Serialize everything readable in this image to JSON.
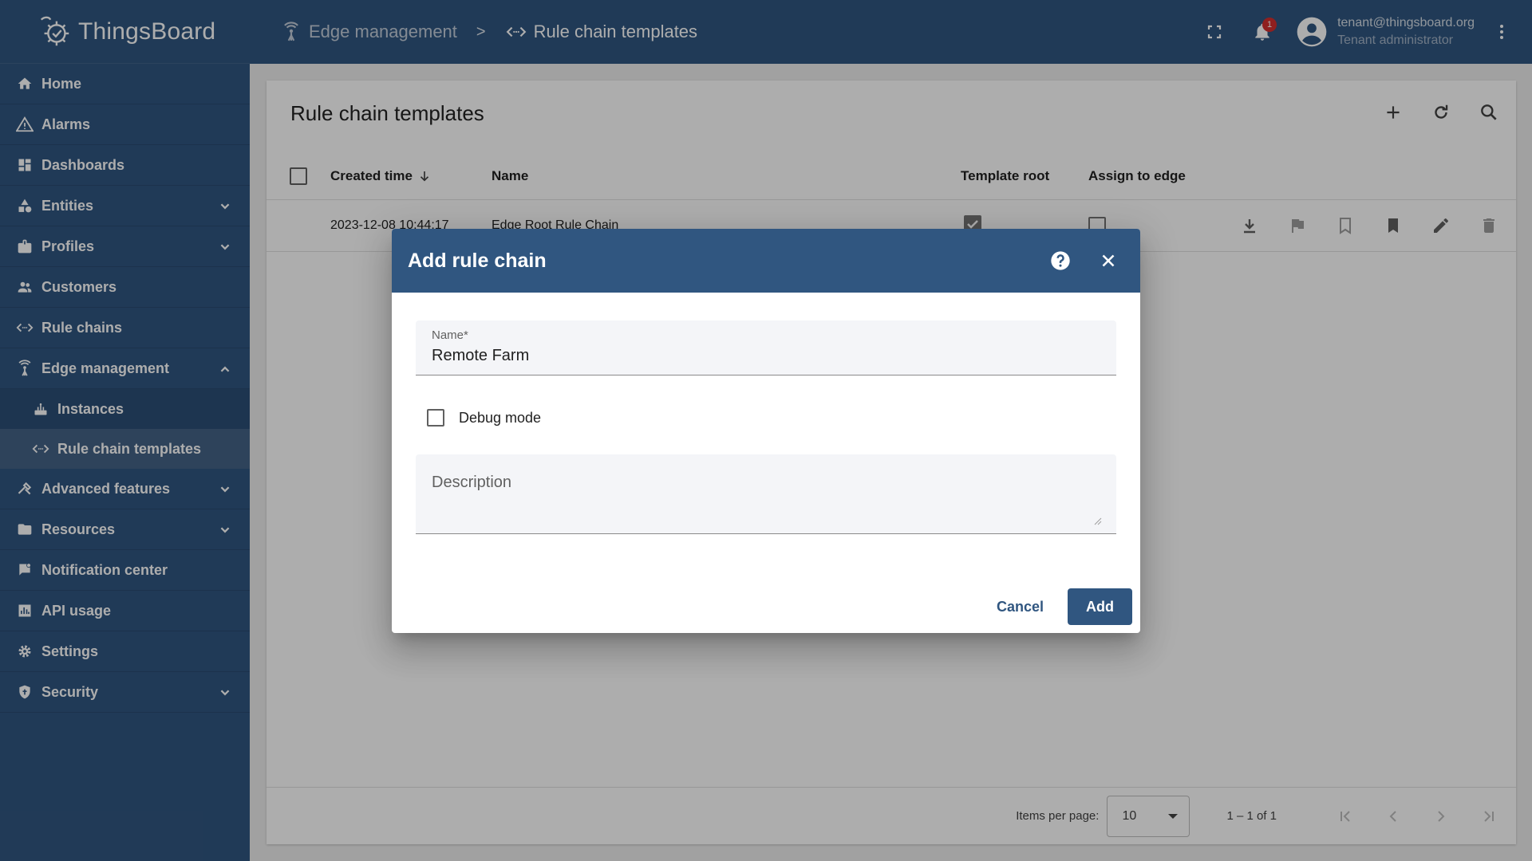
{
  "app": {
    "name": "ThingsBoard"
  },
  "colors": {
    "primary": "#305680",
    "notification_badge": "#d32f2f"
  },
  "sidebar": {
    "items": [
      {
        "label": "Home",
        "icon": "home-icon"
      },
      {
        "label": "Alarms",
        "icon": "warning-icon"
      },
      {
        "label": "Dashboards",
        "icon": "dashboard-icon"
      },
      {
        "label": "Entities",
        "icon": "category-icon",
        "expandable": true
      },
      {
        "label": "Profiles",
        "icon": "badge-icon",
        "expandable": true
      },
      {
        "label": "Customers",
        "icon": "group-icon"
      },
      {
        "label": "Rule chains",
        "icon": "code-icon"
      },
      {
        "label": "Edge management",
        "icon": "router-icon",
        "expanded": true
      },
      {
        "label": "Instances",
        "icon": "edge-instance-icon"
      },
      {
        "label": "Rule chain templates",
        "icon": "code-icon",
        "active": true
      },
      {
        "label": "Advanced features",
        "icon": "construction-icon",
        "expandable": true
      },
      {
        "label": "Resources",
        "icon": "folder-icon",
        "expandable": true
      },
      {
        "label": "Notification center",
        "icon": "notification-icon"
      },
      {
        "label": "API usage",
        "icon": "chart-icon"
      },
      {
        "label": "Settings",
        "icon": "gear-icon"
      },
      {
        "label": "Security",
        "icon": "shield-icon",
        "expandable": true
      }
    ]
  },
  "topbar": {
    "breadcrumb": [
      {
        "label": "Edge management",
        "icon": "router-icon"
      },
      {
        "label": "Rule chain templates",
        "icon": "code-icon"
      }
    ],
    "breadcrumb_sep": ">",
    "notification_count": "1",
    "user": {
      "email": "tenant@thingsboard.org",
      "role": "Tenant administrator"
    }
  },
  "main": {
    "title": "Rule chain templates",
    "columns": {
      "created_time": "Created time",
      "name": "Name",
      "template_root": "Template root",
      "assign_to_edge": "Assign to edge"
    },
    "rows": [
      {
        "created_time": "2023-12-08 10:44:17",
        "name": "Edge Root Rule Chain",
        "template_root": true,
        "assign_to_edge": false
      }
    ],
    "paginator": {
      "items_per_page_label": "Items per page:",
      "items_per_page": "10",
      "range": "1 – 1 of 1"
    }
  },
  "dialog": {
    "title": "Add rule chain",
    "name_label": "Name*",
    "name_value": "Remote Farm",
    "debug_label": "Debug mode",
    "description_placeholder": "Description",
    "cancel_label": "Cancel",
    "add_label": "Add"
  }
}
